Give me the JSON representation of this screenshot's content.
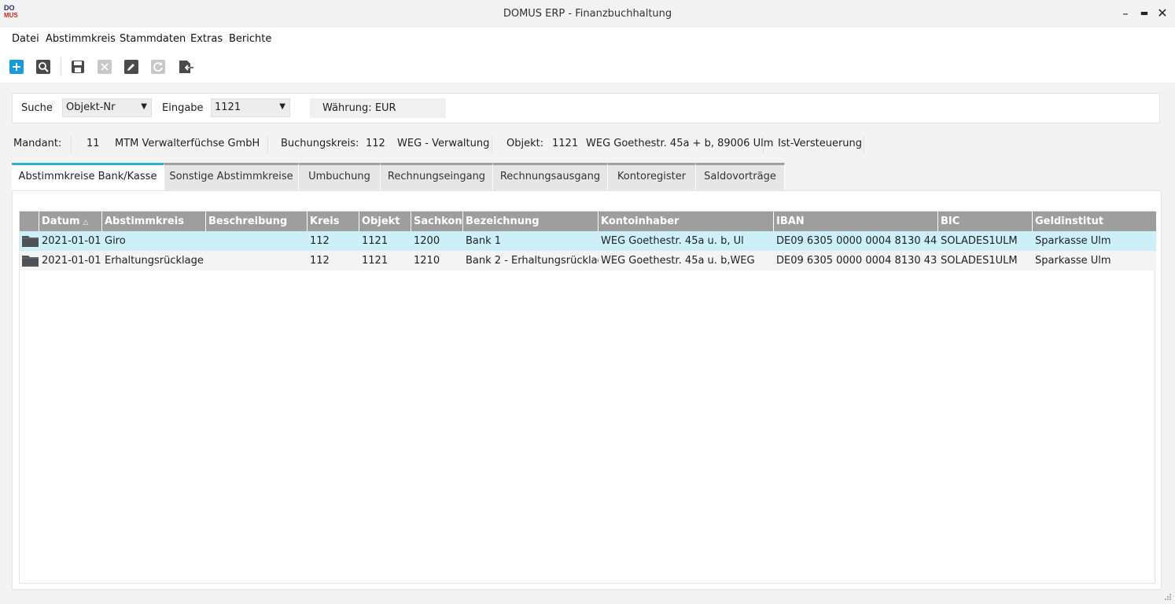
{
  "window": {
    "logo_top": "DO",
    "logo_bottom": "MUS",
    "title": "DOMUS ERP - Finanzbuchhaltung",
    "minimize": "–",
    "maximize": "▬",
    "close": "✕"
  },
  "menu": [
    "Datei",
    "Abstimmkreis",
    "Stammdaten",
    "Extras",
    "Berichte"
  ],
  "toolbar": {
    "icons": [
      "add-icon",
      "search-icon",
      "save-icon",
      "cancel-icon",
      "edit-icon",
      "refresh-icon",
      "exit-icon"
    ]
  },
  "search": {
    "label": "Suche",
    "field_value": "Objekt-Nr",
    "input_label": "Eingabe",
    "input_value": "1121",
    "currency": "Währung: EUR"
  },
  "info": {
    "mandant_label": "Mandant:",
    "mandant_nr": "11",
    "mandant_name": "MTM Verwalterfüchse GmbH",
    "buchungskreis_label": "Buchungskreis:",
    "buchungskreis_nr": "112",
    "buchungskreis_name": "WEG - Verwaltung",
    "objekt_label": "Objekt:",
    "objekt_nr": "1121",
    "objekt_name": "WEG Goethestr. 45a + b, 89006 Ulm",
    "versteuerung": "Ist-Versteuerung"
  },
  "tabs": [
    {
      "label": "Abstimmkreise Bank/Kasse",
      "active": true
    },
    {
      "label": "Sonstige Abstimmkreise",
      "active": false
    },
    {
      "label": "Umbuchung",
      "active": false
    },
    {
      "label": "Rechnungseingang",
      "active": false
    },
    {
      "label": "Rechnungsausgang",
      "active": false
    },
    {
      "label": "Kontoregister",
      "active": false
    },
    {
      "label": "Saldovorträge",
      "active": false
    }
  ],
  "grid": {
    "sort_indicator": "△",
    "columns": [
      "Datum",
      "Abstimmkreis",
      "Beschreibung",
      "Kreis",
      "Objekt",
      "Sachkon",
      "Bezeichnung",
      "Kontoinhaber",
      "IBAN",
      "BIC",
      "Geldinstitut"
    ],
    "rows": [
      [
        "2021-01-01",
        "Giro",
        "",
        "112",
        "1121",
        "1200",
        "Bank 1",
        "WEG Goethestr. 45a u. b, Ul",
        "DE09 6305 0000 0004 8130 44",
        "SOLADES1ULM",
        "Sparkasse Ulm"
      ],
      [
        "2021-01-01",
        "Erhaltungsrücklage",
        "",
        "112",
        "1121",
        "1210",
        "Bank 2 - Erhaltungsrücklag",
        "WEG Goethestr. 45a u. b,WEG",
        "DE09 6305 0000 0004 8130 43",
        "SOLADES1ULM",
        "Sparkasse Ulm"
      ]
    ]
  },
  "colors": {
    "accent": "#2bb3d9",
    "header_bg": "#9e9e9e",
    "selected_row": "#cdeff8",
    "add_button": "#1a9ad6"
  }
}
